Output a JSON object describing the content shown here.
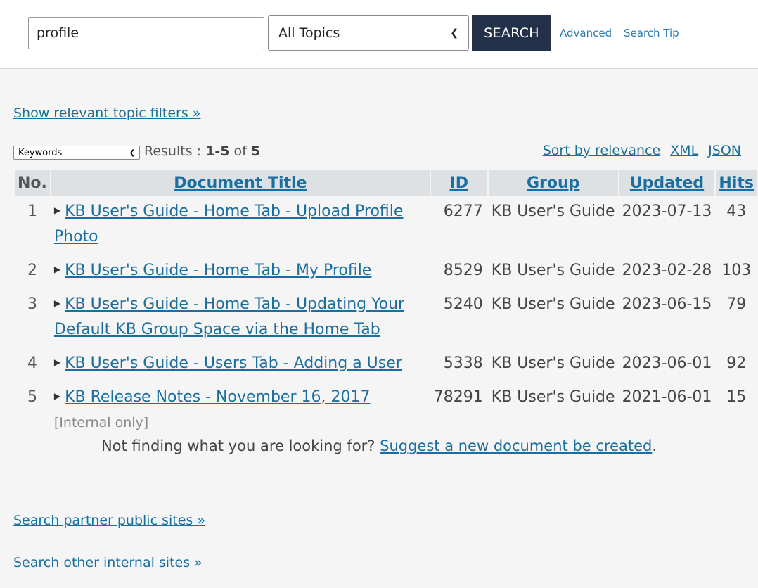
{
  "search": {
    "query": "profile",
    "topic": "All Topics",
    "button_label": "SEARCH",
    "advanced_label": "Advanced",
    "tip_label": "Search Tip"
  },
  "filters_link": "Show relevant topic filters »",
  "keyword_select": "Keywords",
  "results": {
    "label": "Results : ",
    "range": "1-5",
    "of": " of ",
    "total": "5",
    "sort_label": "Sort by relevance",
    "xml_label": "XML",
    "json_label": "JSON"
  },
  "table": {
    "headers": {
      "no": "No.",
      "title": "Document Title",
      "id": "ID",
      "group": "Group",
      "updated": "Updated",
      "hits": "Hits"
    },
    "rows": [
      {
        "no": "1",
        "title": "KB User's Guide - Home Tab - Upload Profile Photo",
        "note": "",
        "id": "6277",
        "group": "KB User's Guide",
        "updated": "2023-07-13",
        "hits": "43"
      },
      {
        "no": "2",
        "title": "KB User's Guide - Home Tab - My Profile",
        "note": "",
        "id": "8529",
        "group": "KB User's Guide",
        "updated": "2023-02-28",
        "hits": "103"
      },
      {
        "no": "3",
        "title": "KB User's Guide - Home Tab - Updating Your Default KB Group Space via the Home Tab",
        "note": "",
        "id": "5240",
        "group": "KB User's Guide",
        "updated": "2023-06-15",
        "hits": "79"
      },
      {
        "no": "4",
        "title": "KB User's Guide - Users Tab - Adding a User",
        "note": "",
        "id": "5338",
        "group": "KB User's Guide",
        "updated": "2023-06-01",
        "hits": "92"
      },
      {
        "no": "5",
        "title": "KB Release Notes - November 16, 2017",
        "note": "[Internal only]",
        "id": "78291",
        "group": "KB User's Guide",
        "updated": "2021-06-01",
        "hits": "15"
      }
    ]
  },
  "footer": {
    "not_finding": "Not finding what you are looking for? ",
    "suggest_link": "Suggest a new document be created",
    "period": ".",
    "partner_link": "Search partner public sites »",
    "internal_link": "Search other internal sites »"
  }
}
